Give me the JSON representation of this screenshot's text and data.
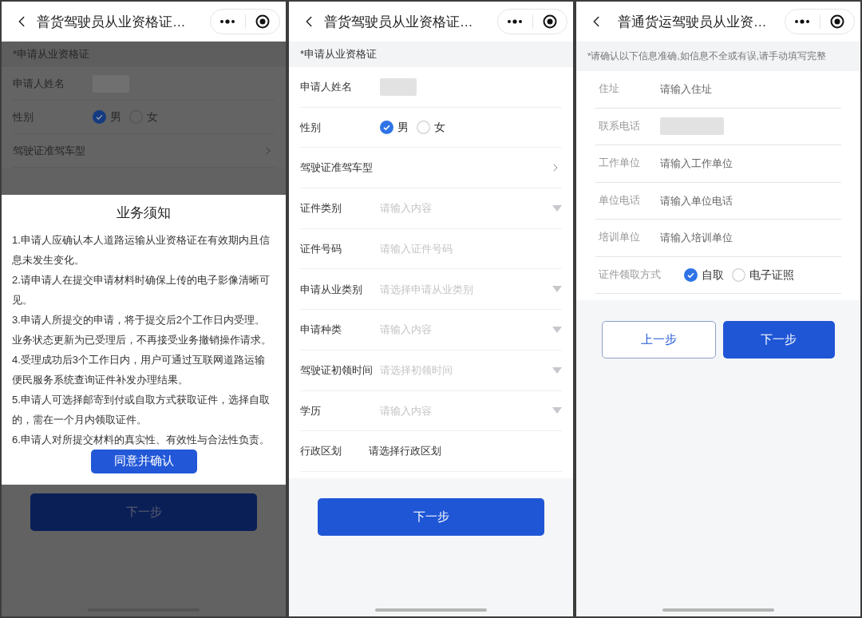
{
  "screens": [
    {
      "title": "普货驾驶员从业资格证…",
      "dimmed": true,
      "kind": "full",
      "section": "*申请从业资格证",
      "rows": [
        {
          "kind": "redacted",
          "label": "申请人姓名"
        },
        {
          "kind": "radio",
          "label": "性别",
          "options": [
            {
              "label": "男",
              "selected": true
            },
            {
              "label": "女",
              "selected": false
            }
          ]
        },
        {
          "kind": "link",
          "label": "驾驶证准驾车型"
        }
      ],
      "modal": {
        "title": "业务须知",
        "items": [
          "1.申请人应确认本人道路运输从业资格证在有效期内且信息未发生变化。",
          "2.请申请人在提交申请材料时确保上传的电子影像清晰可见。",
          "3.申请人所提交的申请，将于提交后2个工作日内受理。业务状态更新为已受理后，不再接受业务撤销操作请求。",
          "4.受理成功后3个工作日内，用户可通过互联网道路运输便民服务系统查询证件补发办理结果。",
          "5.申请人可选择邮寄到付或自取方式获取证件，选择自取的，需在一个月内领取证件。",
          "6.申请人对所提交材料的真实性、有效性与合法性负责。"
        ],
        "button": "同意并确认"
      },
      "buttons": [
        {
          "label": "下一步",
          "kind": "primary"
        }
      ]
    },
    {
      "title": "普货驾驶员从业资格证…",
      "dimmed": false,
      "kind": "full",
      "section": "*申请从业资格证",
      "rows": [
        {
          "kind": "redacted",
          "label": "申请人姓名"
        },
        {
          "kind": "radio",
          "label": "性别",
          "options": [
            {
              "label": "男",
              "selected": true
            },
            {
              "label": "女",
              "selected": false
            }
          ]
        },
        {
          "kind": "link",
          "label": "驾驶证准驾车型"
        },
        {
          "kind": "select",
          "label": "证件类别",
          "placeholder": "请输入内容"
        },
        {
          "kind": "input",
          "label": "证件号码",
          "placeholder": "请输入证件号码"
        },
        {
          "kind": "select",
          "label": "申请从业类别",
          "placeholder": "请选择申请从业类别"
        },
        {
          "kind": "select",
          "label": "申请种类",
          "placeholder": "请输入内容"
        },
        {
          "kind": "select",
          "label": "驾驶证初领时间",
          "placeholder": "请选择初领时间"
        },
        {
          "kind": "select",
          "label": "学历",
          "placeholder": "请输入内容"
        },
        {
          "kind": "picker",
          "label": "行政区划",
          "value": "请选择行政区划"
        }
      ],
      "buttons": [
        {
          "label": "下一步",
          "kind": "primary"
        }
      ]
    },
    {
      "title": "普通货运驾驶员从业资…",
      "dimmed": false,
      "kind": "inset",
      "section": "*请确认以下信息准确,如信息不全或有误,请手动填写完整",
      "rows": [
        {
          "kind": "input",
          "label": "住址",
          "placeholder": "请输入住址"
        },
        {
          "kind": "redacted",
          "label": "联系电话"
        },
        {
          "kind": "input",
          "label": "工作单位",
          "placeholder": "请输入工作单位"
        },
        {
          "kind": "input",
          "label": "单位电话",
          "placeholder": "请输入单位电话"
        },
        {
          "kind": "input",
          "label": "培训单位",
          "placeholder": "请输入培训单位"
        },
        {
          "kind": "radio",
          "label": "证件领取方式",
          "options": [
            {
              "label": "自取",
              "selected": true
            },
            {
              "label": "电子证照",
              "selected": false
            }
          ]
        }
      ],
      "buttons": [
        {
          "label": "上一步",
          "kind": "secondary"
        },
        {
          "label": "下一步",
          "kind": "primary"
        }
      ]
    }
  ]
}
